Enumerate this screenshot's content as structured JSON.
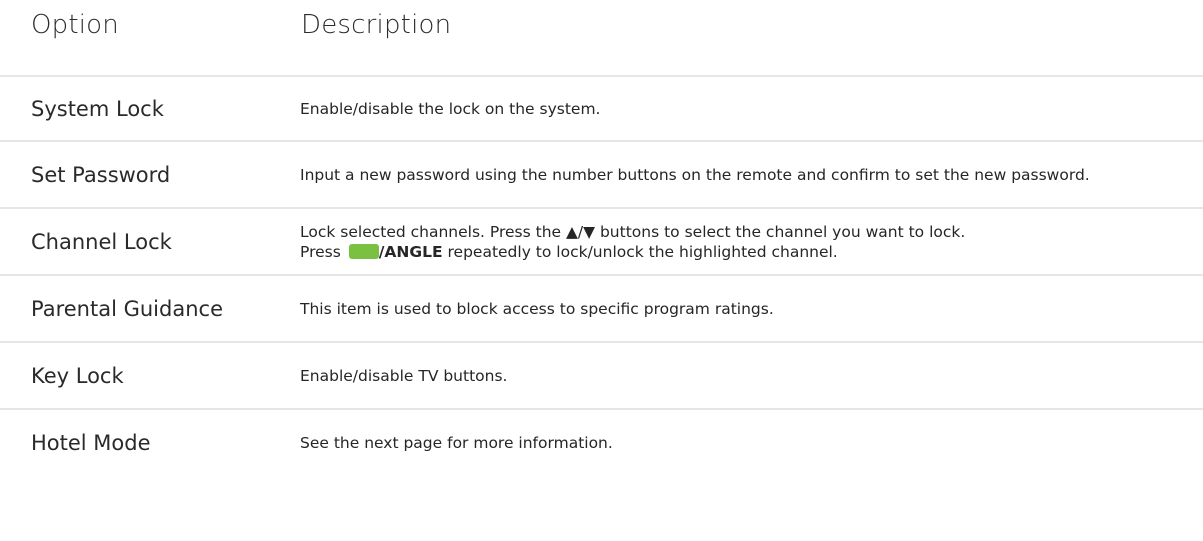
{
  "header": {
    "option": "Option",
    "description": "Description"
  },
  "colors": {
    "green_key": "#7ac142",
    "divider": "#e6e6e6"
  },
  "rows": [
    {
      "option": "System Lock",
      "description": "Enable/disable the lock on the system."
    },
    {
      "option": "Set Password",
      "description": "Input a new password using the number buttons on the remote and confirm to set the new password."
    },
    {
      "option": "Channel Lock",
      "description_line1": "Lock selected channels. Press the ▲/▼ buttons to select the channel you want to lock.",
      "description_press": "Press",
      "description_key": "/ANGLE",
      "description_rest": "repeatedly to lock/unlock the highlighted channel."
    },
    {
      "option": "Parental Guidance",
      "description": "This item is used to block access to specific program ratings."
    },
    {
      "option": "Key Lock",
      "description": "Enable/disable TV buttons."
    },
    {
      "option": "Hotel Mode",
      "description": "See the next page for more information."
    }
  ]
}
